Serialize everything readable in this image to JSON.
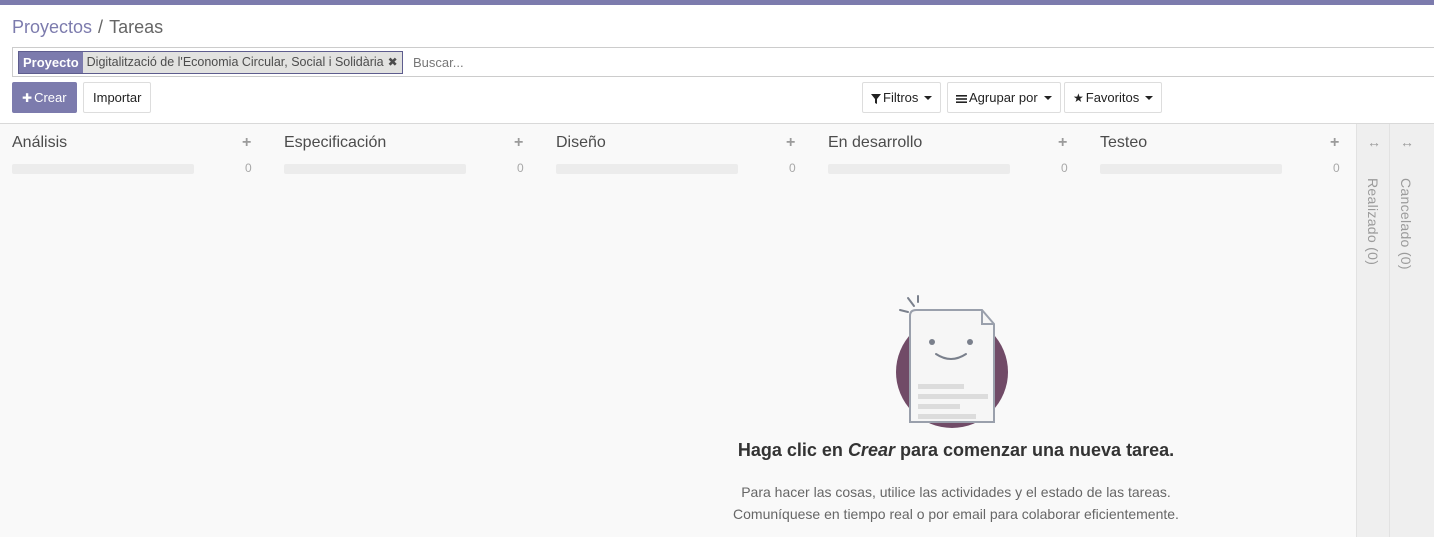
{
  "breadcrumb": {
    "parent": "Proyectos",
    "separator": "/",
    "current": "Tareas"
  },
  "search": {
    "facet_label": "Proyecto",
    "facet_value": "Digitalització de l'Economia Circular, Social i Solidària",
    "placeholder": "Buscar..."
  },
  "buttons": {
    "create": "Crear",
    "import": "Importar",
    "filters": "Filtros",
    "group_by": "Agrupar por",
    "favorites": "Favoritos"
  },
  "columns": [
    {
      "title": "Análisis",
      "count": "0"
    },
    {
      "title": "Especificación",
      "count": "0"
    },
    {
      "title": "Diseño",
      "count": "0"
    },
    {
      "title": "En desarrollo",
      "count": "0"
    },
    {
      "title": "Testeo",
      "count": "0"
    }
  ],
  "folded_columns": [
    {
      "label": "Realizado (0)"
    },
    {
      "label": "Cancelado (0)"
    }
  ],
  "help": {
    "title_prefix": "Haga clic en",
    "title_emphasis": "Crear",
    "title_suffix": "para comenzar una nueva tarea.",
    "line1": "Para hacer las cosas, utilice las actividades y el estado de las tareas.",
    "line2": "Comuníquese en tiempo real o por email para colaborar eficientemente."
  },
  "colors": {
    "brand": "#7c7bad",
    "illustration_circle": "#714b67"
  },
  "icons": {
    "create": "plus-icon",
    "facet_remove": "close-icon",
    "filters": "filter-icon",
    "group_by": "list-icon",
    "favorites": "star-icon",
    "fold_handle": "expand-horizontal-icon"
  }
}
